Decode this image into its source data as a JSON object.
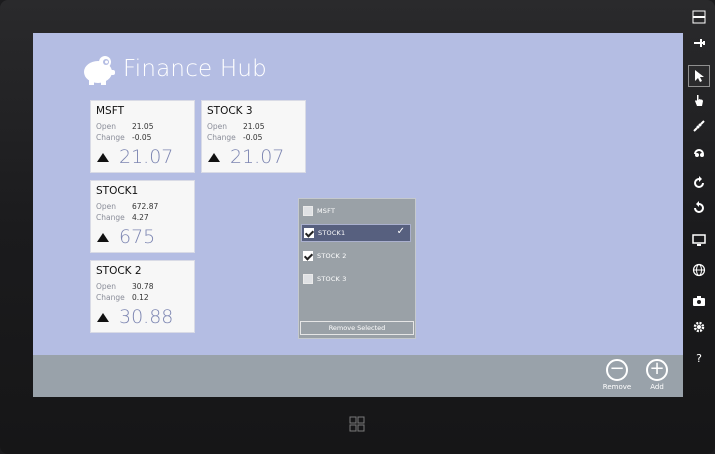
{
  "app": {
    "title": "Finance Hub"
  },
  "tiles": [
    {
      "name": "MSFT",
      "open_label": "Open",
      "open": "21.05",
      "change_label": "Change",
      "change": "-0.05",
      "price": "21.07"
    },
    {
      "name": "STOCK 3",
      "open_label": "Open",
      "open": "21.05",
      "change_label": "Change",
      "change": "-0.05",
      "price": "21.07"
    },
    {
      "name": "STOCK1",
      "open_label": "Open",
      "open": "672.87",
      "change_label": "Change",
      "change": "4.27",
      "price": "675"
    },
    {
      "name": "STOCK 2",
      "open_label": "Open",
      "open": "30.78",
      "change_label": "Change",
      "change": "0.12",
      "price": "30.88"
    }
  ],
  "flyout": {
    "items": [
      {
        "label": "MSFT",
        "checked": false,
        "selected": false
      },
      {
        "label": "STOCK1",
        "checked": true,
        "selected": true
      },
      {
        "label": "STOCK 2",
        "checked": true,
        "selected": false
      },
      {
        "label": "STOCK 3",
        "checked": false,
        "selected": false
      }
    ],
    "remove_selected_label": "Remove Selected"
  },
  "appbar": {
    "remove_label": "Remove",
    "add_label": "Add"
  },
  "simulator_toolbar": {
    "help_label": "?",
    "tools": [
      "minimize-icon",
      "pin-icon",
      "mouse-pointer-icon",
      "touch-icon",
      "pinch-zoom-icon",
      "rotation-touch-icon",
      "rotate-clockwise-icon",
      "rotate-counterclockwise-icon",
      "resolution-icon",
      "location-icon",
      "screenshot-icon",
      "settings-icon",
      "help-icon"
    ]
  },
  "colors": {
    "screen_bg": "#b4bde3",
    "appbar_bg": "#99a2aa",
    "flyout_bg": "#9aa1a7",
    "selected_item_bg": "#57607f",
    "price_color": "#7d86b2"
  }
}
